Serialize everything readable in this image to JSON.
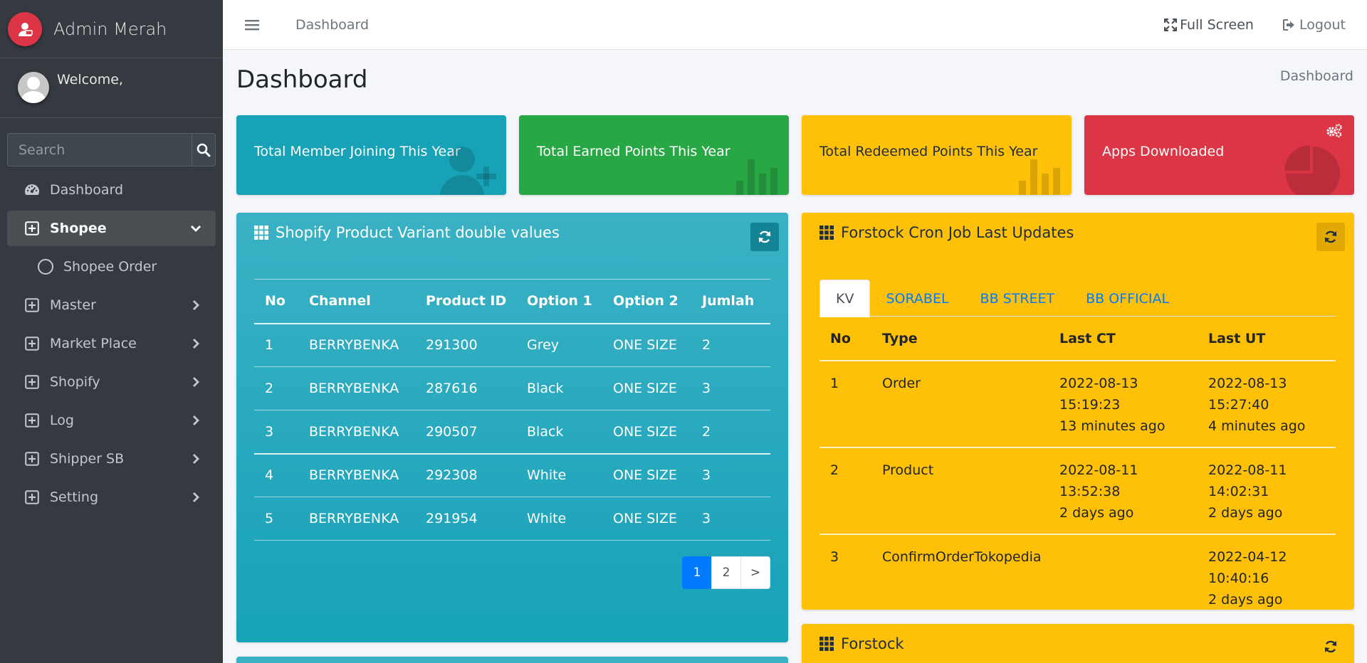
{
  "brand": {
    "name": "Admin Merah"
  },
  "user": {
    "welcome": "Welcome,"
  },
  "search": {
    "placeholder": "Search"
  },
  "sidebar": {
    "items": [
      {
        "label": "Dashboard"
      },
      {
        "label": "Shopee"
      },
      {
        "label": "Shopee Order"
      },
      {
        "label": "Master"
      },
      {
        "label": "Market Place"
      },
      {
        "label": "Shopify"
      },
      {
        "label": "Log"
      },
      {
        "label": "Shipper SB"
      },
      {
        "label": "Setting"
      }
    ]
  },
  "topbar": {
    "link": "Dashboard",
    "fullscreen": "Full Screen",
    "logout": "Logout"
  },
  "header": {
    "title": "Dashboard",
    "breadcrumb": "Dashboard"
  },
  "boxes": [
    {
      "label": "Total Member Joining This Year",
      "color": "#17a2b8"
    },
    {
      "label": "Total Earned Points This Year",
      "color": "#28a745"
    },
    {
      "label": "Total Redeemed Points This Year",
      "color": "#ffc107"
    },
    {
      "label": "Apps Downloaded",
      "color": "#dc3545"
    }
  ],
  "variants": {
    "title": "Shopify Product Variant double values",
    "headers": [
      "No",
      "Channel",
      "Product ID",
      "Option 1",
      "Option 2",
      "Jumlah"
    ],
    "rows": [
      [
        "1",
        "BERRYBENKA",
        "291300",
        "Grey",
        "ONE SIZE",
        "2"
      ],
      [
        "2",
        "BERRYBENKA",
        "287616",
        "Black",
        "ONE SIZE",
        "3"
      ],
      [
        "3",
        "BERRYBENKA",
        "290507",
        "Black",
        "ONE SIZE",
        "2"
      ],
      [
        "4",
        "BERRYBENKA",
        "292308",
        "White",
        "ONE SIZE",
        "3"
      ],
      [
        "5",
        "BERRYBENKA",
        "291954",
        "White",
        "ONE SIZE",
        "3"
      ]
    ],
    "pager": [
      "1",
      "2",
      ">"
    ]
  },
  "cron": {
    "title": "Forstock Cron Job Last Updates",
    "tabs": [
      "KV",
      "SORABEL",
      "BB STREET",
      "BB OFFICIAL"
    ],
    "headers": [
      "No",
      "Type",
      "Last CT",
      "Last UT"
    ],
    "rows": [
      {
        "no": "1",
        "type": "Order",
        "ct": "2022-08-13 15:19:23",
        "ct_ago": "13 minutes ago",
        "ut": "2022-08-13 15:27:40",
        "ut_ago": "4 minutes ago"
      },
      {
        "no": "2",
        "type": "Product",
        "ct": "2022-08-11 13:52:38",
        "ct_ago": "2 days ago",
        "ut": "2022-08-11 14:02:31",
        "ut_ago": "2 days ago"
      },
      {
        "no": "3",
        "type": "ConfirmOrderTokopedia",
        "ct": "",
        "ct_ago": "",
        "ut": "2022-04-12 10:40:16",
        "ut_ago": "2 days ago"
      }
    ]
  },
  "forstock": {
    "title": "Forstock"
  },
  "icons": {
    "brand": "user-logo-icon",
    "search": "search-icon",
    "dashboard": "tachometer-icon",
    "plus_square": "plus-square-icon",
    "chevron_down": "chevron-down-icon",
    "chevron_right": "chevron-right-icon",
    "circle": "circle-icon",
    "menu": "bars-icon",
    "expand": "expand-icon",
    "logout": "sign-out-icon",
    "grid": "th-icon",
    "refresh": "refresh-icon",
    "user_plus": "user-plus-icon",
    "bar_chart": "bar-chart-icon",
    "pie_chart": "pie-chart-icon",
    "cogs": "cogs-icon"
  }
}
